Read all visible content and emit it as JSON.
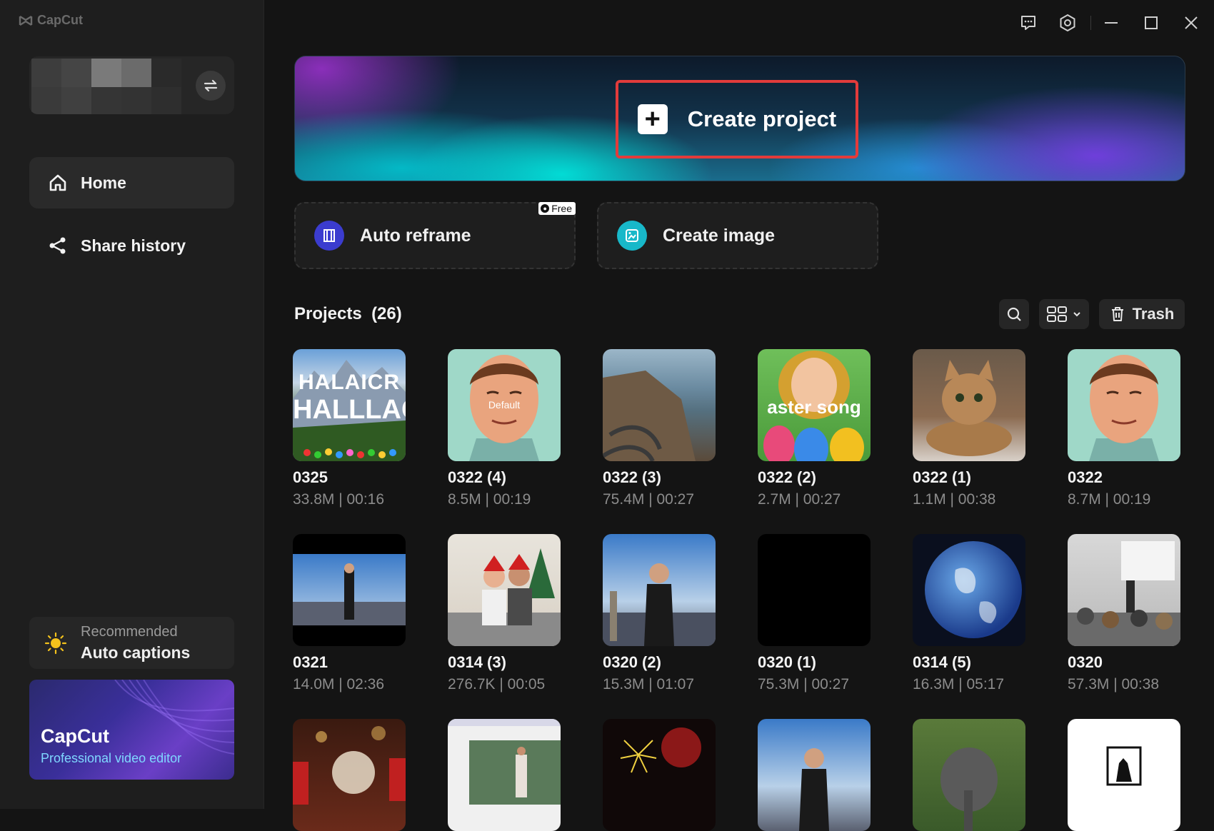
{
  "app": {
    "name": "CapCut"
  },
  "sidebar": {
    "nav": [
      {
        "label": "Home",
        "icon": "home-icon"
      },
      {
        "label": "Share history",
        "icon": "share-icon"
      }
    ],
    "recommended": {
      "label": "Recommended",
      "title": "Auto captions"
    },
    "promo": {
      "title": "CapCut",
      "subtitle": "Professional video editor"
    }
  },
  "hero": {
    "create_label": "Create project"
  },
  "tools": [
    {
      "label": "Auto reframe",
      "badge": "Free"
    },
    {
      "label": "Create image"
    }
  ],
  "projects": {
    "title": "Projects",
    "count": "(26)",
    "trash_label": "Trash",
    "items": [
      {
        "name": "0325",
        "meta": "33.8M | 00:16",
        "thumb_text1": "HALAICR",
        "thumb_text2": "HALLLACH"
      },
      {
        "name": "0322 (4)",
        "meta": "8.5M | 00:19",
        "thumb_text": "Default"
      },
      {
        "name": "0322 (3)",
        "meta": "75.4M | 00:27"
      },
      {
        "name": "0322 (2)",
        "meta": "2.7M | 00:27",
        "thumb_text": "aster song"
      },
      {
        "name": "0322 (1)",
        "meta": "1.1M | 00:38"
      },
      {
        "name": "0322",
        "meta": "8.7M | 00:19"
      },
      {
        "name": "0321",
        "meta": "14.0M | 02:36"
      },
      {
        "name": "0314 (3)",
        "meta": "276.7K | 00:05"
      },
      {
        "name": "0320 (2)",
        "meta": "15.3M | 01:07"
      },
      {
        "name": "0320 (1)",
        "meta": "75.3M | 00:27"
      },
      {
        "name": "0314 (5)",
        "meta": "16.3M | 05:17"
      },
      {
        "name": "0320",
        "meta": "57.3M | 00:38"
      }
    ]
  },
  "colors": {
    "accent_red": "#e23b3b",
    "bg": "#141414",
    "sidebar": "#1e1e1e"
  }
}
